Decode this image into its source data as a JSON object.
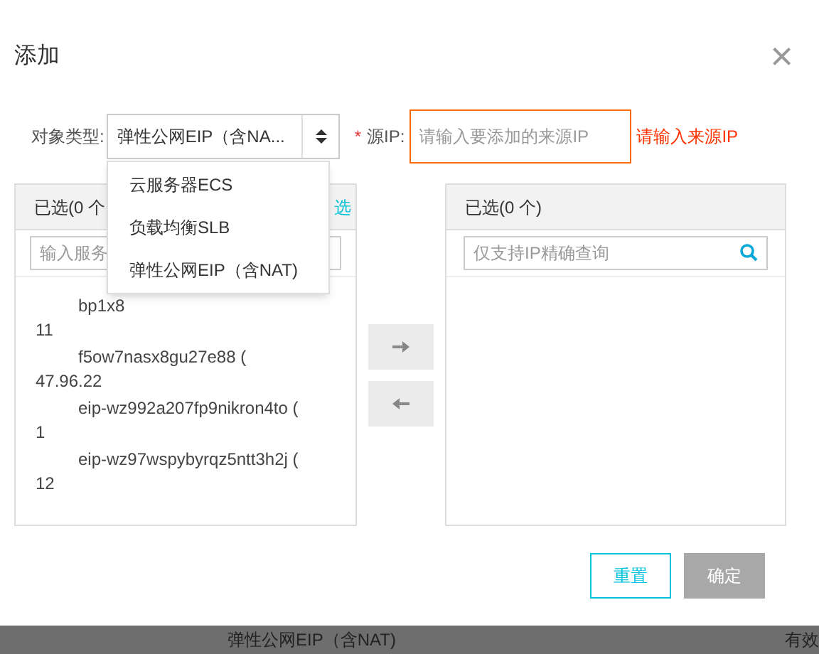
{
  "dialog": {
    "title": "添加",
    "close": "×"
  },
  "form": {
    "type_label": "对象类型:",
    "type_value": "弹性公网EIP（含NA...",
    "required_mark": "*",
    "ip_label": "源IP:",
    "ip_placeholder": "请输入要添加的来源IP",
    "ip_error": "请输入来源IP"
  },
  "dropdown": {
    "options": [
      {
        "label": "云服务器ECS",
        "selected": false
      },
      {
        "label": "负载均衡SLB",
        "selected": false
      },
      {
        "label": "弹性公网EIP（含NAT)",
        "selected": false
      }
    ]
  },
  "left_panel": {
    "header": "已选(0 个",
    "select_all": "选",
    "search_placeholder": "输入服务",
    "items": [
      {
        "line_1": "bp1x8",
        "line_2": "11"
      },
      {
        "line_1": "f5ow7nasx8gu27e88 (",
        "line_2": "47.96.22"
      },
      {
        "line_1": "eip-wz992a207fp9nikron4to (",
        "line_2": "1"
      },
      {
        "line_1": "eip-wz97wspybyrqz5ntt3h2j (",
        "line_2": "12"
      }
    ]
  },
  "right_panel": {
    "header": "已选(0 个)",
    "search_placeholder": "仅支持IP精确查询"
  },
  "buttons": [
    {
      "label": "重置",
      "kind": "outline"
    },
    {
      "label": "确定",
      "kind": "disabled"
    }
  ],
  "background_row": {
    "text": "弹性公网EIP（含NAT)",
    "cut_text": "有效"
  }
}
